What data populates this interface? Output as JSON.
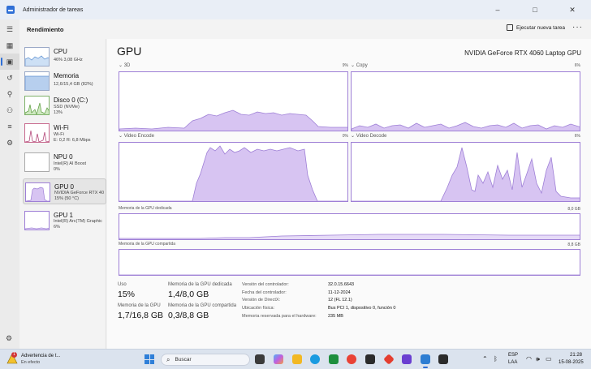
{
  "window": {
    "title": "Administrador de tareas",
    "controls": [
      "–",
      "□",
      "✕"
    ]
  },
  "header": {
    "title": "Rendimiento",
    "run_task": "Ejecutar nueva tarea",
    "more": "···"
  },
  "devices": [
    {
      "name": "CPU",
      "sub1": "46% 3,08 GHz",
      "sub2": ""
    },
    {
      "name": "Memoria",
      "sub1": "12,6/15,4 GB (82%)",
      "sub2": ""
    },
    {
      "name": "Disco 0 (C:)",
      "sub1": "SSD (NVMe)",
      "sub2": "13%"
    },
    {
      "name": "Wi-Fi",
      "sub1": "Wi-Fi",
      "sub2": "E: 0,2 R: 6,8 Mbps"
    },
    {
      "name": "NPU 0",
      "sub1": "Intel(R) AI Boost",
      "sub2": "0%"
    },
    {
      "name": "GPU 0",
      "sub1": "NVIDIA GeForce RTX 40",
      "sub2": "15% (50 °C)"
    },
    {
      "name": "GPU 1",
      "sub1": "Intel(R) Arc(TM) Graphic",
      "sub2": "6%"
    }
  ],
  "gpu": {
    "title": "GPU",
    "model": "NVIDIA GeForce RTX 4060 Laptop GPU",
    "engines": [
      {
        "label": "3D",
        "pct": "9%"
      },
      {
        "label": "Copy",
        "pct": "6%"
      },
      {
        "label": "Video Encode",
        "pct": "0%"
      },
      {
        "label": "Video Decode",
        "pct": "6%"
      }
    ],
    "dedicated_label": "Memoria de la GPU dedicada",
    "dedicated_max": "8,0 GB",
    "shared_label": "Memoria de la GPU compartida",
    "shared_max": "8,8 GB"
  },
  "stats": {
    "uso_label": "Uso",
    "uso_value": "15%",
    "dedicated_label": "Memoria de la GPU dedicada",
    "dedicated_value": "1,4/8,0 GB",
    "gpu_mem_label": "Memoria de la GPU",
    "gpu_mem_value": "1,7/16,8 GB",
    "shared_label": "Memoria de la GPU compartida",
    "shared_value": "0,3/8,8 GB"
  },
  "info": [
    {
      "k": "Versión del controlador:",
      "v": "32.0.15.6643"
    },
    {
      "k": "Fecha del controlador:",
      "v": "11-12-2024"
    },
    {
      "k": "Versión de DirectX:",
      "v": "12 (FL 12.1)"
    },
    {
      "k": "Ubicación física:",
      "v": "Bus PCI 1, dispositivo 0, función 0"
    },
    {
      "k": "Memoria reservada para el hardware:",
      "v": "235 MB"
    }
  ],
  "taskbar": {
    "alert_title": "Advertencia de t...",
    "alert_sub": "En efecto",
    "alert_badge": "1",
    "search": "Buscar",
    "lang1": "ESP",
    "lang2": "LAA",
    "time": "21:28",
    "date": "15-08-2025"
  },
  "colors": {
    "accent": "#2f6fd6",
    "graph_fill": "#d7c4f2",
    "graph_line": "#9e7fd6"
  }
}
